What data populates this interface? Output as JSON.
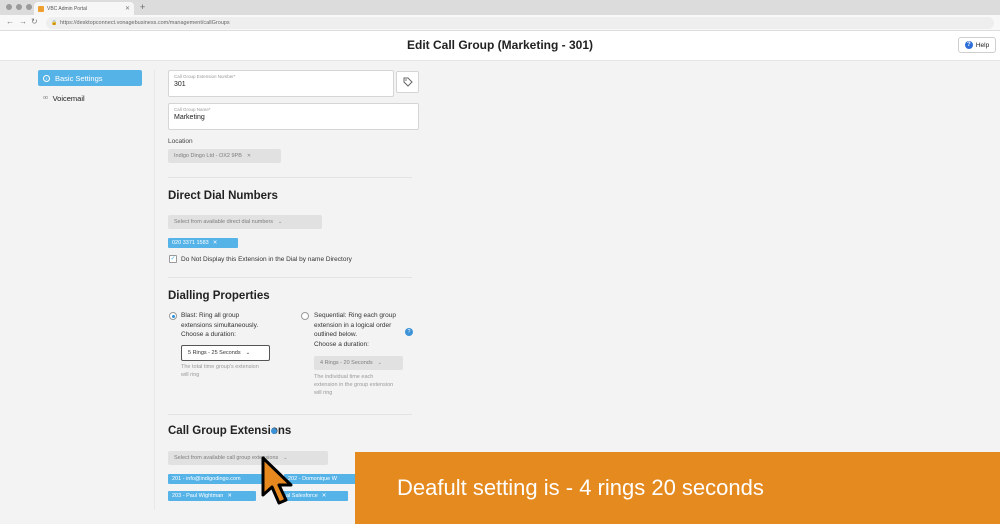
{
  "browser": {
    "tab_title": "VBC Admin Portal",
    "url": "https://desktopconnect.vonagebusiness.com/management/callGroups"
  },
  "header": {
    "title": "Edit Call Group (Marketing - 301)",
    "help_label": "Help"
  },
  "sidebar": {
    "items": [
      {
        "label": "Basic Settings",
        "active": true,
        "icon": "settings-circle-icon"
      },
      {
        "label": "Voicemail",
        "active": false,
        "icon": "voicemail-icon"
      }
    ]
  },
  "form": {
    "extension_number": {
      "label": "Call Group Extension Number*",
      "value": "301"
    },
    "group_name": {
      "label": "Call Group Name*",
      "value": "Marketing"
    },
    "location": {
      "label": "Location",
      "value": "Indigo Dingo Ltd - OX2 9PB"
    }
  },
  "direct_dial": {
    "heading": "Direct Dial Numbers",
    "select_placeholder": "Select from available direct dial numbers",
    "numbers": [
      "020 3371 1583"
    ],
    "checkbox_label": "Do Not Display this Extension in the Dial by name Directory"
  },
  "dialling": {
    "heading": "Dialling Properties",
    "blast": {
      "lines": [
        "Blast: Ring all group",
        "extensions simultaneously."
      ],
      "duration_label": "Choose a duration:",
      "duration": "5 Rings - 25 Seconds",
      "help": [
        "The total time group's extension",
        "will ring"
      ],
      "selected": true
    },
    "sequential": {
      "lines": [
        "Sequential: Ring each group",
        "extension in a logical order",
        "outlined below."
      ],
      "duration_label": "Choose a duration:",
      "duration": "4 Rings - 20 Seconds",
      "help": [
        "The individual time each",
        "extension in the group extension",
        "will ring"
      ],
      "selected": false
    }
  },
  "extensions": {
    "heading": "Call Group Extensions",
    "select_placeholder": "Select from available call group extensions",
    "chips": [
      "201 - info@indigodingo.com",
      "202 - Domonique W",
      "203 - Paul Wightman",
      "al Salesforce"
    ]
  },
  "banner": {
    "text": "Deafult setting is - 4 rings 20 seconds"
  },
  "colors": {
    "accent": "#56b3e8",
    "banner": "#e58a1f"
  }
}
